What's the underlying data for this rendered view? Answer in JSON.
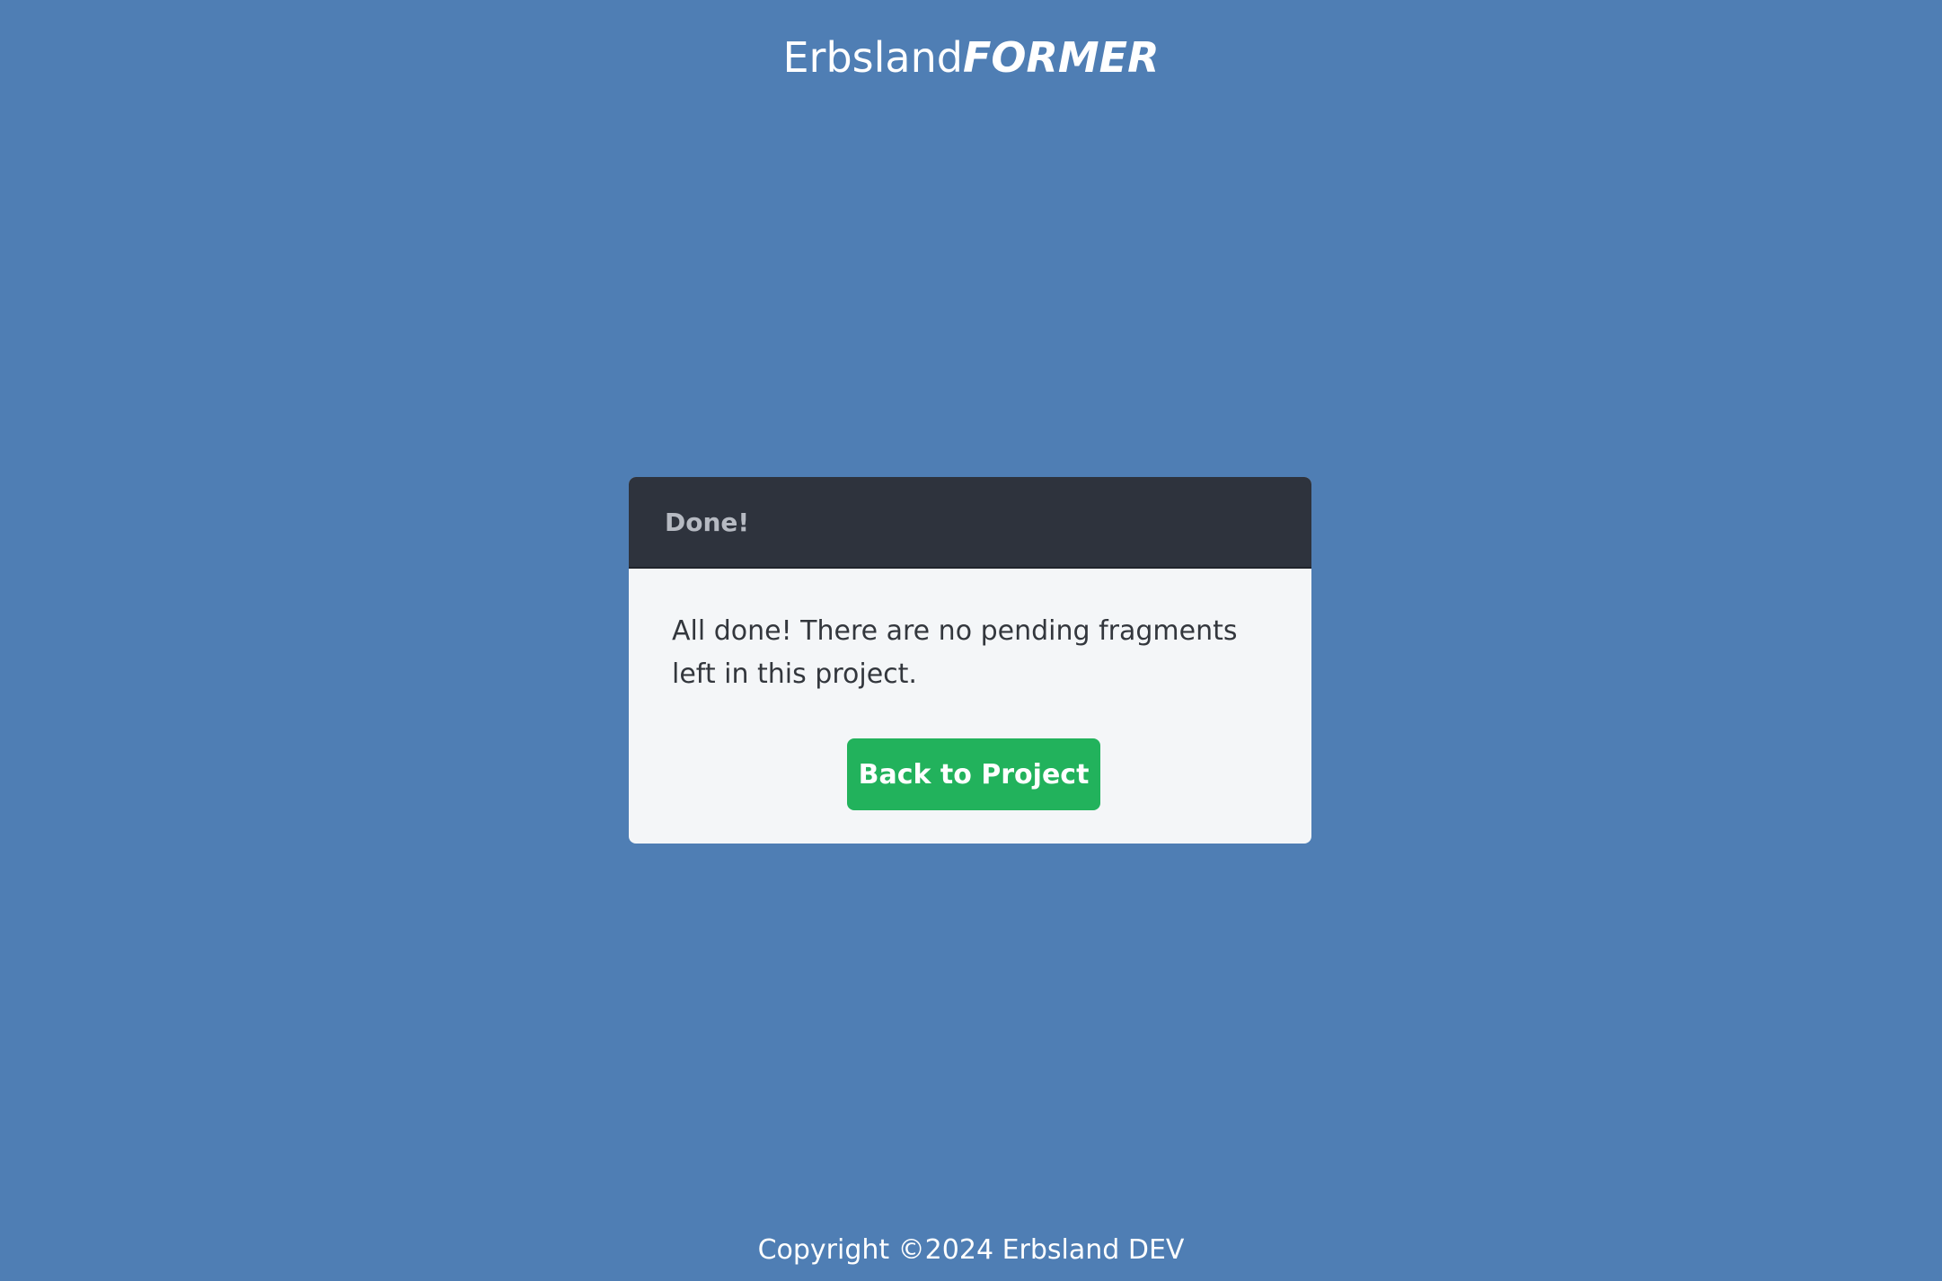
{
  "header": {
    "brand_prefix": "Erbsland",
    "brand_suffix": "FORMER"
  },
  "dialog": {
    "title": "Done!",
    "message": "All done! There are no pending fragments left in this project.",
    "button_label": "Back to Project"
  },
  "footer": {
    "copyright": "Copyright ©2024 Erbsland DEV"
  },
  "colors": {
    "page_background": "#4f7eb4",
    "dialog_header": "#2e333d",
    "dialog_body": "#f4f6f8",
    "primary_button": "#22b25c"
  }
}
